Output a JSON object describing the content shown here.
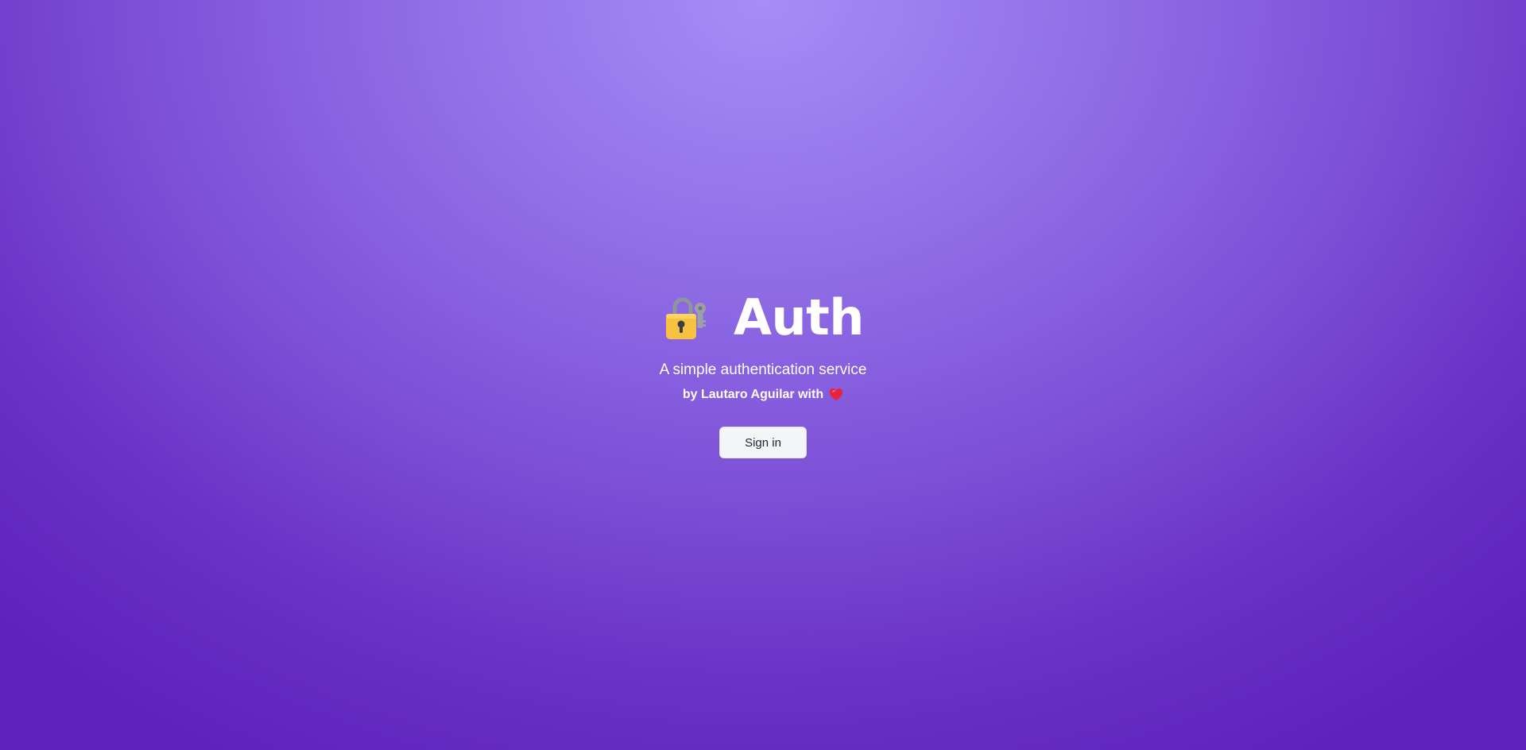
{
  "hero": {
    "title": "Auth",
    "subtitle": "A simple authentication service",
    "byline": "by Lautaro Aguilar with",
    "title_icon": "lock-with-key-icon",
    "byline_icon": "heart-icon"
  },
  "actions": {
    "sign_in_label": "Sign in"
  },
  "colors": {
    "background_light": "#a78cf6",
    "background_dark": "#5d22bb",
    "text": "#ffffff",
    "button_bg": "#f3f5f7",
    "button_text": "#1f2430",
    "heart": "#e8243c",
    "lock_body": "#f7c23f"
  }
}
